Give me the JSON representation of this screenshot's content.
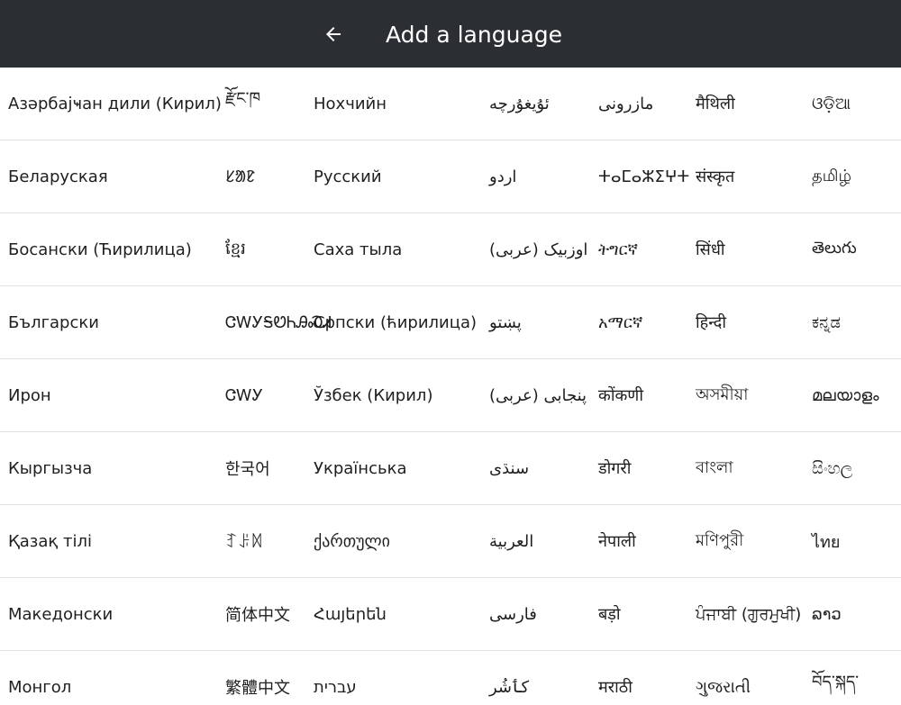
{
  "toolbar": {
    "title": "Add a language",
    "back_icon": "arrow-left-icon"
  },
  "languages": [
    [
      "Азәрбајҹан дили (Кирил)",
      "རྫོང་ཁ",
      "Нохчийн",
      "ئۇيغۇرچە",
      "مازرونی",
      "मैथिली",
      "ଓଡ଼ିଆ"
    ],
    [
      "Беларуская",
      "ᱥᱟᱱ",
      "Русский",
      "اردو",
      "ⵜⴰⵎⴰⵣⵉⵖⵜ",
      "संस्कृत",
      "தமிழ்"
    ],
    [
      "Босански (Ћирилица)",
      "ខ្មែរ",
      "Саха тыла",
      "اوزبیک (عربی)",
      "ትግርኛ",
      "सिंधी",
      "తెలుగు"
    ],
    [
      "Български",
      "ᏣᎳᎩᎦᏬᏂᎯᏍᏗ",
      "Српски (ћирилица)",
      "پښتو",
      "አማርኛ",
      "हिन्दी",
      "ಕನ್ನಡ"
    ],
    [
      "Ирон",
      "ᏣᎳᎩ",
      "Ўзбек (Кирил)",
      "پنجابی (عربی)",
      "कोंकणी",
      "অসমীয়া",
      "മലയാളം"
    ],
    [
      "Кыргызча",
      "한국어",
      "Українська",
      "سنڌی",
      "डोगरी",
      "বাংলা",
      "සිංහල"
    ],
    [
      "Қазақ тілі",
      "ꆈꌠꉙ",
      "ქართული",
      "العربية",
      "नेपाली",
      "মণিপুরী",
      "ไทย"
    ],
    [
      "Македонски",
      "简体中文",
      "Հայերեն",
      "فارسی",
      "बड़ो",
      "ਪੰਜਾਬੀ (ਗੁਰਮੁਖੀ)",
      "ລາວ"
    ],
    [
      "Монгол",
      "繁體中文",
      "עברית",
      "کٲشُر",
      "मराठी",
      "ગુજરાતી",
      "བོད་སྐད་"
    ]
  ]
}
